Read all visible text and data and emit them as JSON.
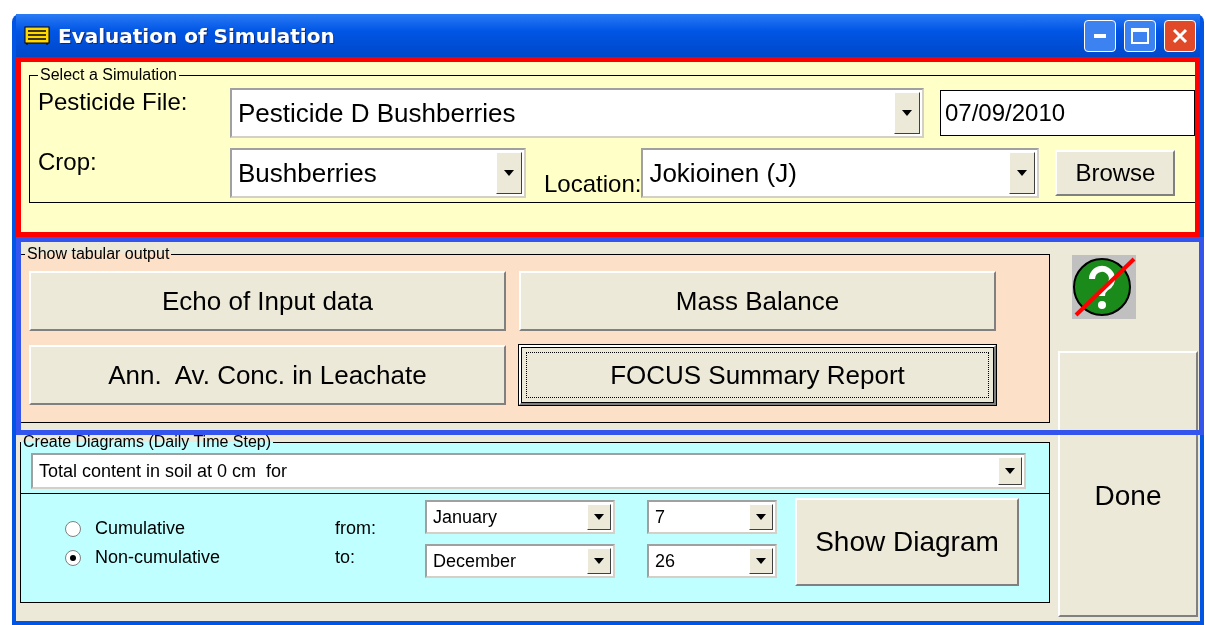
{
  "window": {
    "title": "Evaluation of Simulation"
  },
  "select_simulation": {
    "label": "Select a Simulation",
    "pesticide_file_label": "Pesticide File:",
    "pesticide_file": "Pesticide D Bushberries",
    "date": "07/09/2010",
    "crop_label": "Crop:",
    "crop": "Bushberries",
    "location_label": "Location:",
    "location": "Jokioinen (J)",
    "browse_button": "Browse"
  },
  "tabular_output": {
    "label": "Show tabular output",
    "buttons": [
      {
        "label": "Echo of Input data",
        "focused": false
      },
      {
        "label": "Mass Balance",
        "focused": false
      },
      {
        "label": "Ann.  Av. Conc. in Leachate",
        "focused": false
      },
      {
        "label": "FOCUS Summary Report",
        "focused": true
      }
    ]
  },
  "diagrams": {
    "label": "Create Diagrams (Daily Time Step)",
    "variable": "Total content in soil at 0 cm  for",
    "modes": [
      {
        "label": "Cumulative",
        "selected": false
      },
      {
        "label": "Non-cumulative",
        "selected": true
      }
    ],
    "from_label": "from:",
    "to_label": "to:",
    "from_month": "January",
    "from_day": "7",
    "to_month": "December",
    "to_day": "26",
    "show_button": "Show Diagram"
  },
  "done_button": "Done"
}
